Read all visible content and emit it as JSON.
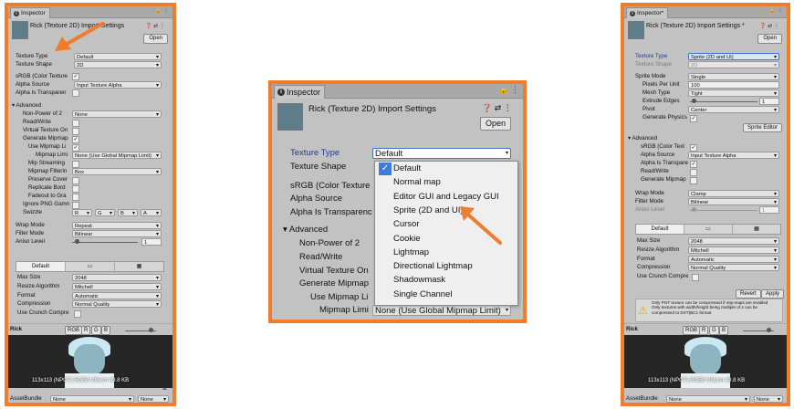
{
  "colors": {
    "highlight": "#f07c2c",
    "panel_bg": "#c2c2c2",
    "link_blue": "#1e3a9a",
    "check_blue": "#3d7dd8"
  },
  "left": {
    "tab_label": "Inspector",
    "title": "Rick (Texture 2D) Import Settings",
    "open_label": "Open",
    "texture_type_label": "Texture Type",
    "texture_type_value": "Default",
    "texture_shape_label": "Texture Shape",
    "texture_shape_value": "2D",
    "srgb_label": "sRGB (Color Texture",
    "alpha_source_label": "Alpha Source",
    "alpha_source_value": "Input Texture Alpha",
    "alpha_transparent_label": "Alpha Is Transparen",
    "advanced_label": "Advanced",
    "npot_label": "Non-Power of 2",
    "npot_value": "None",
    "readwrite_label": "Read/Write",
    "virtual_label": "Virtual Texture On",
    "genmip_label": "Generate Mipmap",
    "usemip_label": "Use Mipmap Li",
    "miplimit_label": "Mipmap Limi",
    "miplimit_value": "None (Use Global Mipmap Limit)",
    "mipstream_label": "Mip Streaming",
    "mipfilter_label": "Mipmap Filterin",
    "mipfilter_value": "Box",
    "preserve_label": "Preserve Cover",
    "replicate_label": "Replicate Bord",
    "fadeout_label": "Fadeout to Gra",
    "ignorepng_label": "Ignore PNG Gamn",
    "swizzle_label": "Swizzle",
    "swizzle_r": "R",
    "swizzle_g": "G",
    "swizzle_b": "B",
    "swizzle_a": "A",
    "wrap_label": "Wrap Mode",
    "wrap_value": "Repeat",
    "filter_label": "Filter Mode",
    "filter_value": "Bilinear",
    "aniso_label": "Aniso Level",
    "aniso_value": "1",
    "platform_tab_default": "Default",
    "maxsize_label": "Max Size",
    "maxsize_value": "2048",
    "resize_label": "Resize Algorithm",
    "resize_value": "Mitchell",
    "format_label": "Format",
    "format_value": "Automatic",
    "compression_label": "Compression",
    "compression_value": "Normal Quality",
    "crunch_label": "Use Crunch Compre",
    "preview_name": "Rick",
    "preview_channel": "RGB",
    "preview_r": "R",
    "preview_g": "G",
    "preview_b": "B",
    "preview_info": "113x113 (NPOT) RGB8 UNorm 49.8 KB",
    "assetbundle_label": "AssetBundle",
    "assetbundle_value": "None",
    "assetbundle_variant": "None"
  },
  "middle": {
    "tab_label": "Inspector",
    "title": "Rick (Texture 2D) Import Settings",
    "open_label": "Open",
    "texture_type_label": "Texture Type",
    "texture_type_value": "Default",
    "texture_shape_label": "Texture Shape",
    "srgb_label": "sRGB (Color Texture",
    "alpha_source_label": "Alpha Source",
    "alpha_transparent_label": "Alpha Is Transparenc",
    "advanced_label": "Advanced",
    "npot_label": "Non-Power of 2",
    "readwrite_label": "Read/Write",
    "virtual_label": "Virtual Texture On",
    "genmip_label": "Generate Mipmap",
    "usemip_label": "Use Mipmap Li",
    "miplimit_label": "Mipmap Limi",
    "miplimit_value": "None (Use Global Mipmap Limit)",
    "options": [
      "Default",
      "Normal map",
      "Editor GUI and Legacy GUI",
      "Sprite (2D and UI)",
      "Cursor",
      "Cookie",
      "Lightmap",
      "Directional Lightmap",
      "Shadowmask",
      "Single Channel"
    ]
  },
  "right": {
    "tab_label": "Inspector*",
    "title": "Rick (Texture 2D) Import Settings *",
    "open_label": "Open",
    "texture_type_label": "Texture Type",
    "texture_type_value": "Sprite (2D and UI)",
    "texture_shape_label": "Texture Shape",
    "texture_shape_value": "2D",
    "sprite_mode_label": "Sprite Mode",
    "sprite_mode_value": "Single",
    "ppu_label": "Pixels Per Unit",
    "ppu_value": "100",
    "mesh_label": "Mesh Type",
    "mesh_value": "Tight",
    "extrude_label": "Extrude Edges",
    "extrude_value": "1",
    "pivot_label": "Pivot",
    "pivot_value": "Center",
    "physics_label": "Generate Physics",
    "sprite_editor_label": "Sprite Editor",
    "advanced_label": "Advanced",
    "srgb_label": "sRGB (Color Text",
    "alpha_source_label": "Alpha Source",
    "alpha_source_value": "Input Texture Alpha",
    "alpha_transparent_label": "Alpha Is Transpare",
    "readwrite_label": "Read/Write",
    "genmip_label": "Generate Mipmap",
    "wrap_label": "Wrap Mode",
    "wrap_value": "Clamp",
    "filter_label": "Filter Mode",
    "filter_value": "Bilinear",
    "aniso_label": "Aniso Level",
    "aniso_value": "1",
    "platform_tab_default": "Default",
    "maxsize_label": "Max Size",
    "maxsize_value": "2048",
    "resize_label": "Resize Algorithm",
    "resize_value": "Mitchell",
    "format_label": "Format",
    "format_value": "Automatic",
    "compression_label": "Compression",
    "compression_value": "Normal Quality",
    "crunch_label": "Use Crunch Compre",
    "revert_label": "Revert",
    "apply_label": "Apply",
    "warning_text_1": "Only POT texture can be compressed if mip-maps are enabled",
    "warning_text_2": "Only textures with width/height being multiple of 4 can be compressed to DXT(BC1 format",
    "preview_name": "Rick",
    "preview_channel": "RGB",
    "preview_r": "R",
    "preview_g": "G",
    "preview_b": "B",
    "preview_info": "113x113 (NPOT) RGB8 UNorm 49.8 KB",
    "assetbundle_label": "AssetBundle",
    "assetbundle_value": "None",
    "assetbundle_variant": "None"
  }
}
